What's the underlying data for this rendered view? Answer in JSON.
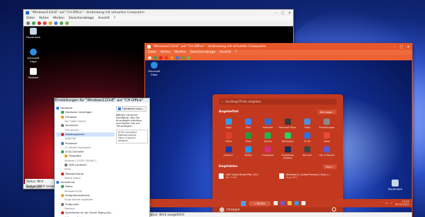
{
  "vm1": {
    "title": "\"Windows11OnE\" auf \"CH-Office\" - Verbindung mit virtuellen Computern",
    "menu": [
      "Datei",
      "Aktion",
      "Medien",
      "Zwischenablage",
      "Ansicht",
      "?"
    ],
    "desktop_icons": [
      {
        "label": "Papierkorb",
        "icon": "recycle-bin-icon"
      },
      {
        "label": "Microsoft Edge",
        "icon": "edge-icon"
      },
      {
        "label": "Dispose",
        "icon": "file-icon"
      }
    ],
    "status": "Status: Wird ausgeführt"
  },
  "vm2": {
    "title": "\"Windows11OnE\" auf \"CH-Office\" - Verbindung mit virtuellen Computern",
    "menu": [
      "Datei",
      "Aktion",
      "Medien",
      "Zwischenablage",
      "Ansicht",
      "?"
    ],
    "desktop_icons": [
      {
        "label": "Microsoft Edge",
        "icon": "edge-icon"
      },
      {
        "label": "Papierkorb",
        "icon": "recycle-bin-icon"
      }
    ],
    "start_menu": {
      "search_placeholder": "Suchbegriff hier eingeben",
      "pinned_heading": "Angeheftet",
      "all_apps": "Alle Apps",
      "pinned_apps": [
        {
          "label": "Edge",
          "color": "#2f9de8"
        },
        {
          "label": "Mail",
          "color": "#3b82f6"
        },
        {
          "label": "Kalender",
          "color": "#2b6fd6"
        },
        {
          "label": "Microsoft Store",
          "color": "#3a3a3a"
        },
        {
          "label": "Fotos",
          "color": "#4a90e2"
        },
        {
          "label": "Einstellungen",
          "color": "#8a8a8a"
        },
        {
          "label": "Office",
          "color": "#e0402b"
        },
        {
          "label": "Xbox",
          "color": "#1e9e3a"
        },
        {
          "label": "Spotify",
          "color": "#1db954"
        },
        {
          "label": "WhatsApp",
          "color": "#25d366"
        },
        {
          "label": "To Do",
          "color": "#2f6fe0"
        },
        {
          "label": "News",
          "color": "#e84a3a"
        },
        {
          "label": "Disney+",
          "color": "#1c3b9e"
        },
        {
          "label": "Twitter",
          "color": "#1d9bf0"
        },
        {
          "label": "Instagram",
          "color": "#d6307a"
        },
        {
          "label": "Photoshop Express",
          "color": "#1a2d5c"
        },
        {
          "label": "Rechner",
          "color": "#444444"
        },
        {
          "label": "Uhr & Wecker",
          "color": "#5b5bd6"
        }
      ],
      "recommended_heading": "Empfohlen",
      "more": "Mehr",
      "recommended": [
        {
          "name": "LIVE Social Media Plan 1/22",
          "sub": "Vor 2 Std."
        },
        {
          "name": "Windows11_InsiderPreview_Client_x...",
          "sub": "Aug 2021"
        }
      ],
      "user": "Christoph"
    },
    "taskbar": {
      "search": "Suche",
      "time": "17:23",
      "date": "09.02.2022"
    },
    "status": "Status: Wird ausgeführt"
  },
  "settings": {
    "title": "Einstellungen für \"Windows11OnE\" auf \"CH-Office\"",
    "tree": [
      {
        "label": "Hardware",
        "level": 0,
        "sub": ""
      },
      {
        "label": "Hardware hinzufügen",
        "level": 1,
        "sub": ""
      },
      {
        "label": "Firmware",
        "level": 1,
        "sub": "Von \"Datei\" starten"
      },
      {
        "label": "Sicherheit",
        "level": 1,
        "sub": "TPM aktiviert"
      },
      {
        "label": "Arbeitsspeicher",
        "level": 1,
        "sub": "16384 MB",
        "selected": true
      },
      {
        "label": "Prozessor",
        "level": 1,
        "sub": "12 virtuelle Prozessoren"
      },
      {
        "label": "SCSI-Controller",
        "level": 1,
        "sub": ""
      },
      {
        "label": "Festplatte",
        "level": 2,
        "sub": "Windows 11 IDEV_CROWN 1..."
      },
      {
        "label": "DVD-Laufwerk",
        "level": 2,
        "sub": "Keine"
      },
      {
        "label": "Netzwerkkarte",
        "level": 1,
        "sub": "Default Switch"
      },
      {
        "label": "Verwaltung",
        "level": 0,
        "sub": ""
      },
      {
        "label": "Name",
        "level": 1,
        "sub": "Windows11OnE"
      },
      {
        "label": "Integrationsdienste",
        "level": 1,
        "sub": "Einige Dienste angeboten"
      },
      {
        "label": "Prüfpunkte",
        "level": 1,
        "sub": "Standard"
      },
      {
        "label": "Speicherort für die Smart Paging-Da...",
        "level": 1,
        "sub": "C:\\ProgramData\\..."
      }
    ],
    "right_heading": "Hardware hinzu...",
    "right_text": "Wählen Sie einen Gerätetyp, den Sie hinzufügen möchten, und klicken Sie auf \"Hinzufügen\".",
    "right_items": [
      "SCSI-Controller",
      "Netzwerkkarte",
      "Fibre Channel-Adapter"
    ]
  }
}
